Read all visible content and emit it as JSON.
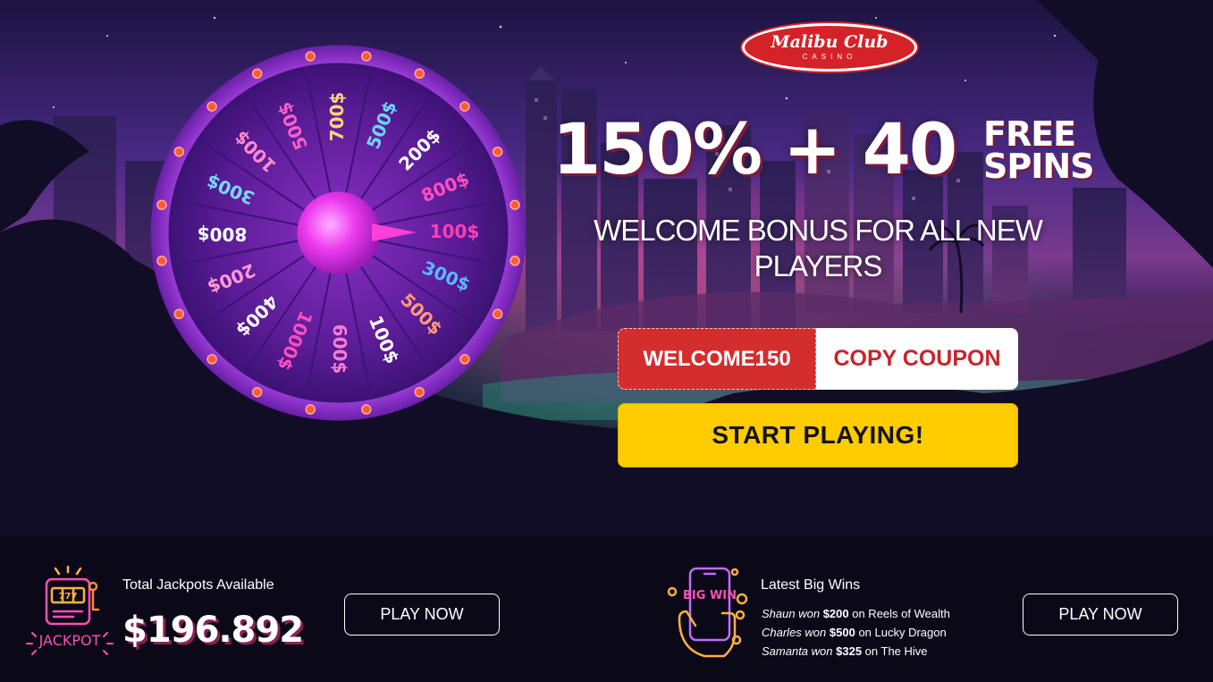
{
  "brand": {
    "name": "Malibu Club",
    "sub": "CASINO",
    "color": "#d42228"
  },
  "hero": {
    "headline_main": "150% + 40",
    "headline_free_1": "FREE",
    "headline_free_2": "SPINS",
    "subheadline": "WELCOME BONUS FOR ALL NEW PLAYERS",
    "coupon_code": "WELCOME150",
    "copy_coupon_label": "COPY COUPON",
    "start_label": "START PLAYING!",
    "start_color": "#ffcc00"
  },
  "wheel": {
    "segments": [
      "100$",
      "300$",
      "500$",
      "100$",
      "600$",
      "1000$",
      "400$",
      "200$",
      "800$",
      "300$",
      "100$",
      "500$",
      "700$",
      "500$",
      "200$",
      "800$"
    ],
    "segment_colors": [
      "#ff3fb3",
      "#57b9ff",
      "#ff9a7a",
      "#ffffff",
      "#ff7bd5",
      "#ff4fc0",
      "#ffffff",
      "#ff9ad6",
      "#ffffff",
      "#7ad6ff",
      "#ff8ad0",
      "#ff5ec8",
      "#ffd37a",
      "#6fd3ff",
      "#ffffff",
      "#ff4fc0"
    ]
  },
  "jackpot": {
    "label": "Total Jackpots Available",
    "value": "$196.892",
    "icon_text": "JACKPOT",
    "icon_reels": "777",
    "play_label": "PLAY NOW"
  },
  "wins": {
    "label": "Latest Big Wins",
    "icon_text": "BIG WIN",
    "entries": [
      {
        "name": "Shaun won",
        "amount": "$200",
        "game": "on Reels of Wealth"
      },
      {
        "name": "Charles won",
        "amount": "$500",
        "game": "on Lucky Dragon"
      },
      {
        "name": "Samanta won",
        "amount": "$325",
        "game": "on The Hive"
      }
    ],
    "play_label": "PLAY NOW"
  }
}
